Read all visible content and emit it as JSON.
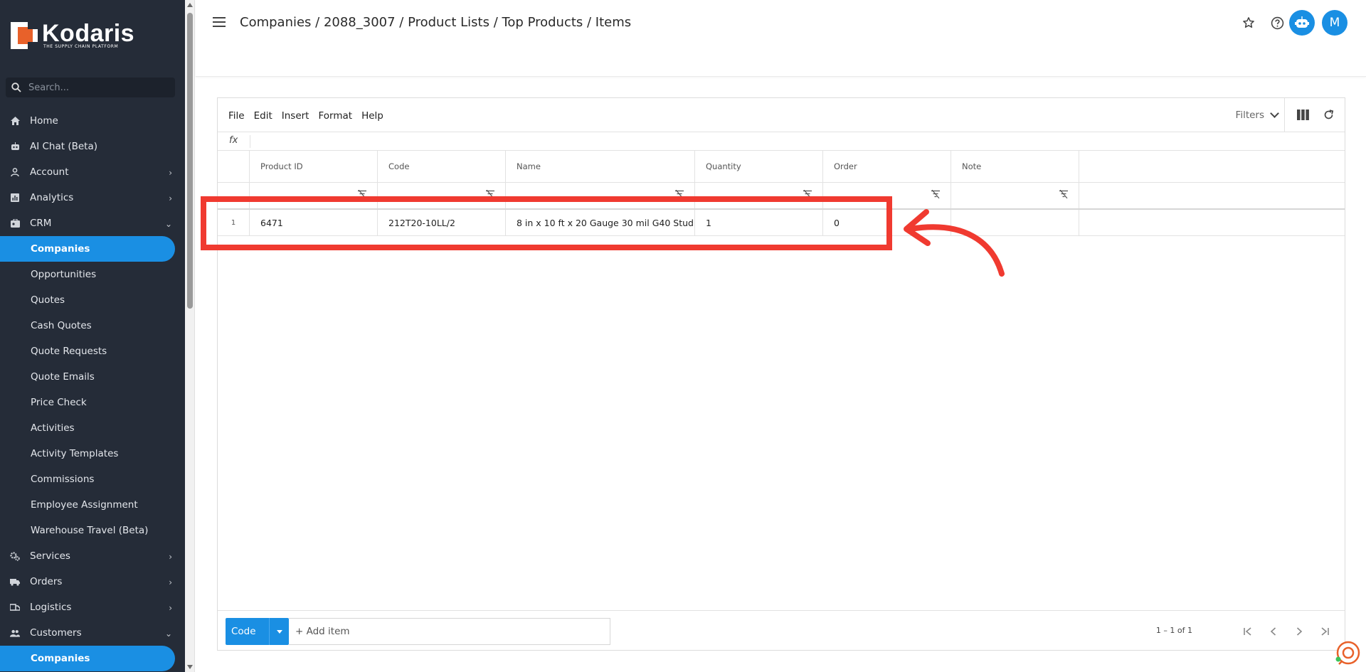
{
  "brand": {
    "name": "Kodaris",
    "tagline": "THE SUPPLY CHAIN PLATFORM",
    "accent": "#1a8fe3",
    "logo_orange": "#e8612a"
  },
  "search": {
    "placeholder": "Search..."
  },
  "sidebar": {
    "items": [
      {
        "label": "Home",
        "icon": "home-icon"
      },
      {
        "label": "AI Chat (Beta)",
        "icon": "robot-icon"
      },
      {
        "label": "Account",
        "icon": "person-icon",
        "chevron": "right"
      },
      {
        "label": "Analytics",
        "icon": "analytics-icon",
        "chevron": "right"
      },
      {
        "label": "CRM",
        "icon": "crm-icon",
        "chevron": "down"
      },
      {
        "label": "Companies",
        "sub": true,
        "active": true
      },
      {
        "label": "Opportunities",
        "sub": true
      },
      {
        "label": "Quotes",
        "sub": true
      },
      {
        "label": "Cash Quotes",
        "sub": true
      },
      {
        "label": "Quote Requests",
        "sub": true
      },
      {
        "label": "Quote Emails",
        "sub": true
      },
      {
        "label": "Price Check",
        "sub": true
      },
      {
        "label": "Activities",
        "sub": true
      },
      {
        "label": "Activity Templates",
        "sub": true
      },
      {
        "label": "Commissions",
        "sub": true
      },
      {
        "label": "Employee Assignment",
        "sub": true
      },
      {
        "label": "Warehouse Travel (Beta)",
        "sub": true
      },
      {
        "label": "Services",
        "icon": "gears-icon",
        "chevron": "right"
      },
      {
        "label": "Orders",
        "icon": "truck-icon",
        "chevron": "right"
      },
      {
        "label": "Logistics",
        "icon": "logistics-icon",
        "chevron": "right"
      },
      {
        "label": "Customers",
        "icon": "people-icon",
        "chevron": "down"
      },
      {
        "label": "Companies",
        "sub": true,
        "active": true
      }
    ]
  },
  "header": {
    "breadcrumb": "Companies / 2088_3007 / Product Lists / Top Products / Items",
    "avatar_initial": "M"
  },
  "toolbar": {
    "menu": [
      "File",
      "Edit",
      "Insert",
      "Format",
      "Help"
    ],
    "filters_label": "Filters",
    "fx_label": "fx"
  },
  "table": {
    "columns": [
      "",
      "Product ID",
      "Code",
      "Name",
      "Quantity",
      "Order",
      "Note"
    ],
    "rows": [
      {
        "row_num": "1",
        "product_id": "6471",
        "code": "212T20-10LL/2",
        "name": "8 in x 10 ft x 20 Gauge 30 mil G40 Stud...",
        "quantity": "1",
        "order": "0",
        "note": ""
      }
    ]
  },
  "footer": {
    "code_button": "Code",
    "add_item_placeholder": "+ Add item",
    "page_info": "1 – 1 of 1"
  },
  "annotation": {
    "color": "#f03a30"
  }
}
